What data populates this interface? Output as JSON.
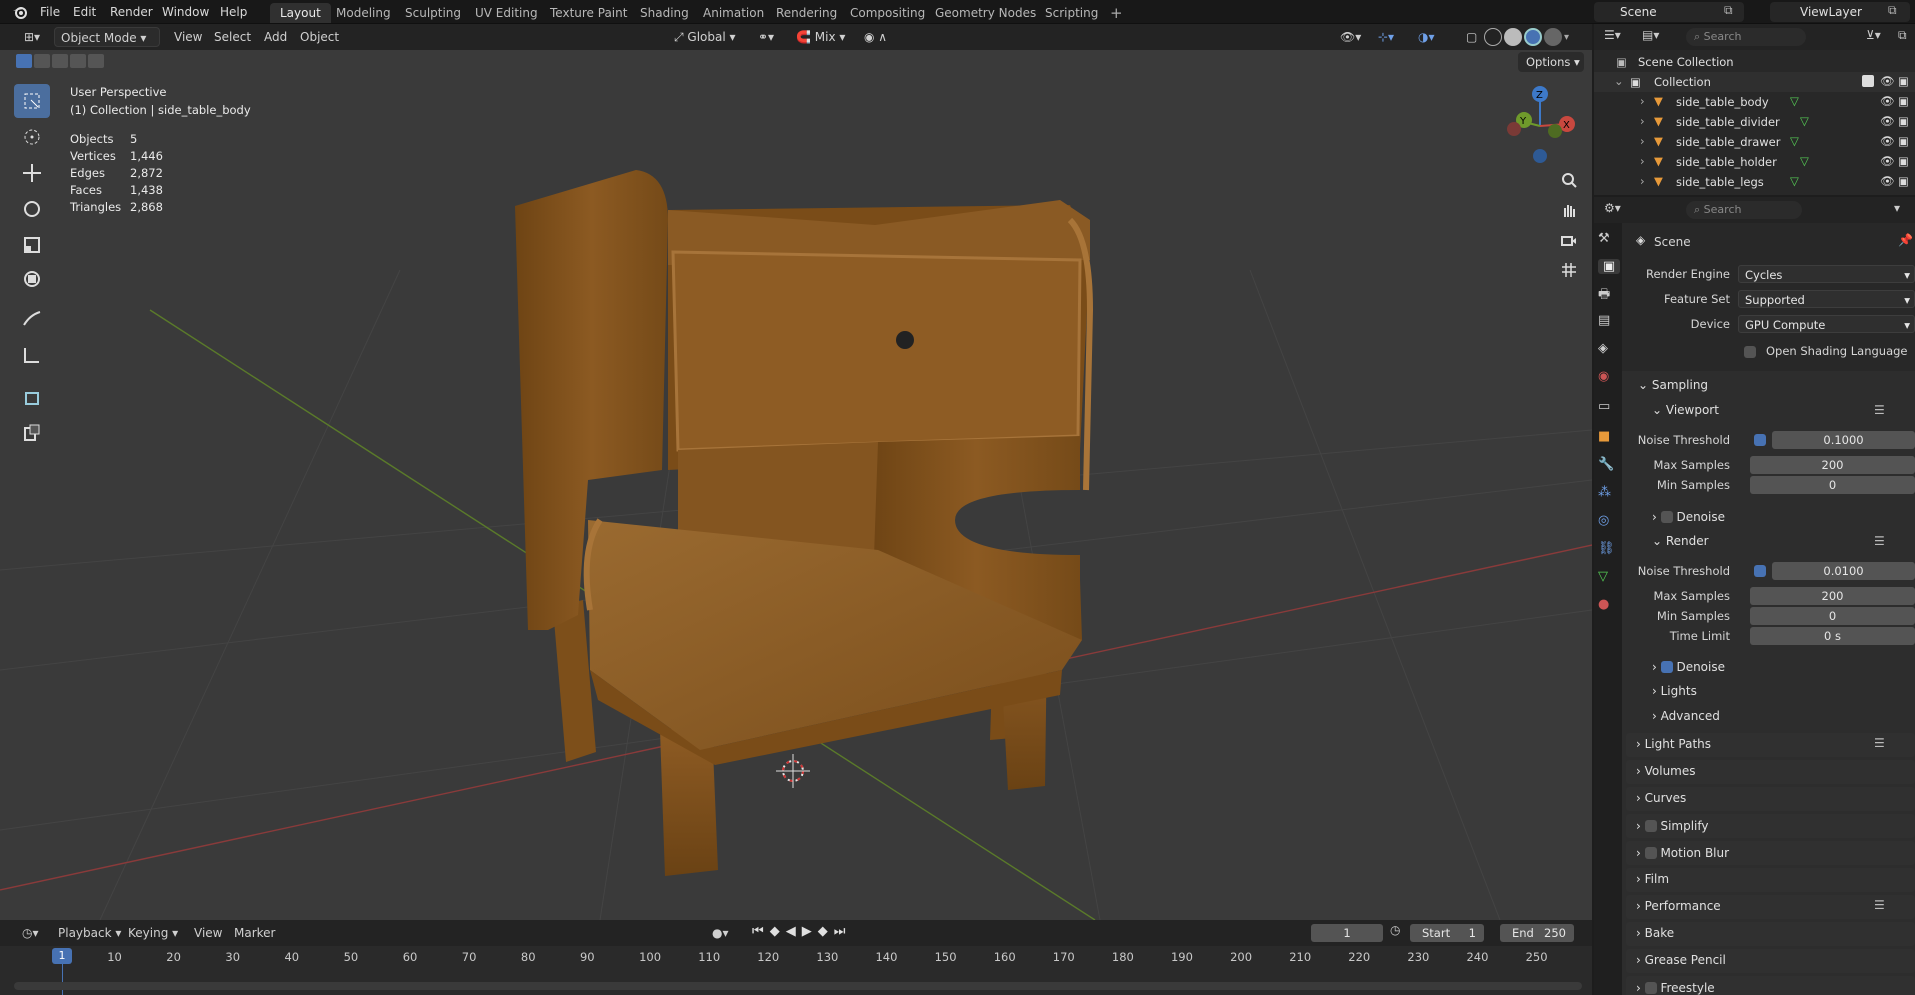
{
  "menus": [
    "File",
    "Edit",
    "Render",
    "Window",
    "Help"
  ],
  "workspaces": [
    "Layout",
    "Modeling",
    "Sculpting",
    "UV Editing",
    "Texture Paint",
    "Shading",
    "Animation",
    "Rendering",
    "Compositing",
    "Geometry Nodes",
    "Scripting"
  ],
  "active_workspace": "Layout",
  "scene_name": "Scene",
  "viewlayer_name": "ViewLayer",
  "viewport_header": {
    "mode": "Object Mode",
    "menus": [
      "View",
      "Select",
      "Add",
      "Object"
    ],
    "orientation": "Global",
    "snap_mode": "Mix",
    "options": "Options"
  },
  "viewport": {
    "perspective": "User Perspective",
    "context": "(1) Collection | side_table_body",
    "stats": [
      {
        "label": "Objects",
        "value": "5"
      },
      {
        "label": "Vertices",
        "value": "1,446"
      },
      {
        "label": "Edges",
        "value": "2,872"
      },
      {
        "label": "Faces",
        "value": "1,438"
      },
      {
        "label": "Triangles",
        "value": "2,868"
      }
    ],
    "gizmo_axes": [
      "X",
      "Y",
      "Z"
    ],
    "tools": [
      "select-box-icon",
      "cursor-icon",
      "move-icon",
      "rotate-icon",
      "scale-icon",
      "transform-icon",
      "annotate-icon",
      "measure-icon",
      "add-cube-icon",
      "extrude-icon"
    ],
    "nav_icons": [
      "zoom-icon",
      "hand-icon",
      "camera-icon",
      "grid-icon"
    ]
  },
  "timeline": {
    "menus": [
      "Playback",
      "Keying",
      "View",
      "Marker"
    ],
    "current_frame": "1",
    "start_label": "Start",
    "start": "1",
    "end_label": "End",
    "end": "250",
    "ticks": [
      "1",
      "10",
      "20",
      "30",
      "40",
      "50",
      "60",
      "70",
      "80",
      "90",
      "100",
      "110",
      "120",
      "130",
      "140",
      "150",
      "160",
      "170",
      "180",
      "190",
      "200",
      "210",
      "220",
      "230",
      "240",
      "250"
    ]
  },
  "outliner": {
    "search_placeholder": "Search",
    "scene_collection": "Scene Collection",
    "collection": "Collection",
    "objects": [
      "side_table_body",
      "side_table_divider",
      "side_table_drawer",
      "side_table_holder",
      "side_table_legs"
    ]
  },
  "properties": {
    "search_placeholder": "Search",
    "context": "Scene",
    "render_engine_label": "Render Engine",
    "render_engine": "Cycles",
    "feature_set_label": "Feature Set",
    "feature_set": "Supported",
    "device_label": "Device",
    "device": "GPU Compute",
    "osl_label": "Open Shading Language",
    "sampling": "Sampling",
    "viewport": "Viewport",
    "noise_threshold_label": "Noise Threshold",
    "vp_noise_threshold": "0.1000",
    "max_samples_label": "Max Samples",
    "vp_max_samples": "200",
    "min_samples_label": "Min Samples",
    "vp_min_samples": "0",
    "denoise_label": "Denoise",
    "render": "Render",
    "r_noise_threshold": "0.0100",
    "r_max_samples": "200",
    "r_min_samples": "0",
    "time_limit_label": "Time Limit",
    "r_time_limit": "0 s",
    "lights": "Lights",
    "advanced": "Advanced",
    "panels": [
      "Light Paths",
      "Volumes",
      "Curves",
      "Simplify",
      "Motion Blur",
      "Film",
      "Performance",
      "Bake",
      "Grease Pencil",
      "Freestyle"
    ]
  },
  "colors": {
    "accent": "#4772b3",
    "x_axis": "#c8483f",
    "y_axis": "#6f9a2b",
    "z_axis": "#3d79c9",
    "wood": "#8a5a22"
  }
}
